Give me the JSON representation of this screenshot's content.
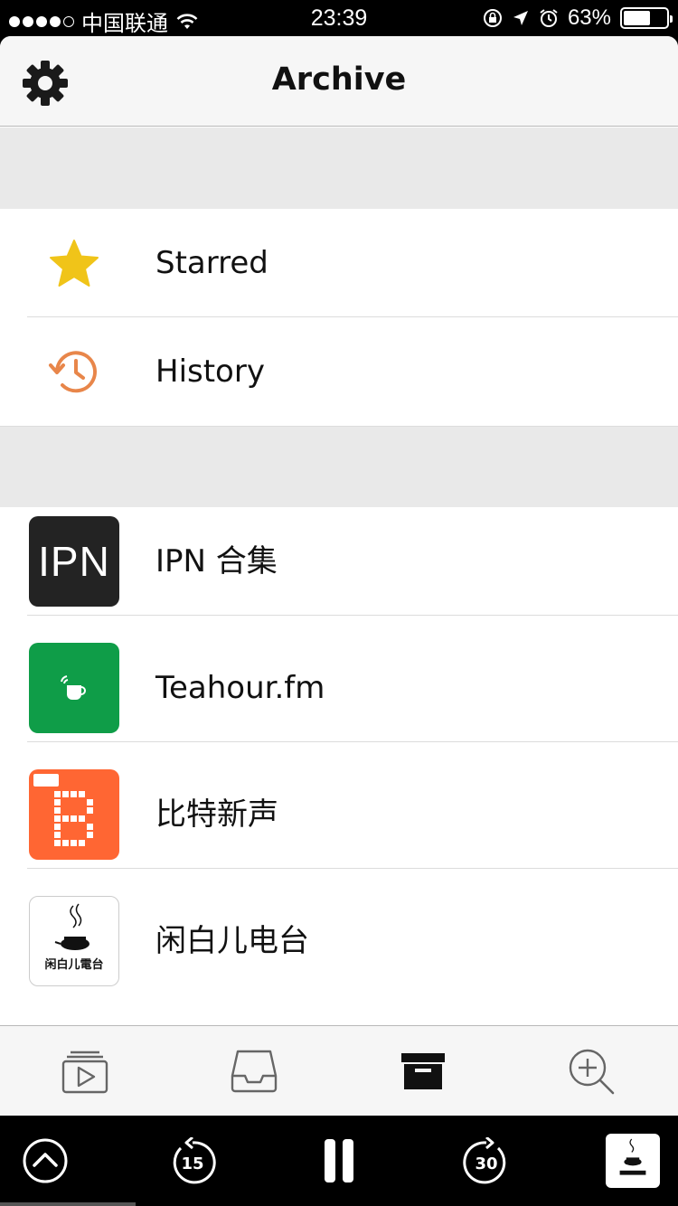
{
  "status_bar": {
    "carrier": "中国联通",
    "time": "23:39",
    "battery_text": "63%",
    "battery_level": 0.63
  },
  "header": {
    "title": "Archive",
    "settings_icon": "gear-icon"
  },
  "archive_items": [
    {
      "label": "Starred",
      "icon": "star-icon",
      "color": "#f0c419"
    },
    {
      "label": "History",
      "icon": "history-icon",
      "color": "#e8864a"
    }
  ],
  "podcasts": [
    {
      "title": "IPN 合集",
      "art_text": "IPN"
    },
    {
      "title": "Teahour.fm"
    },
    {
      "title": "比特新声",
      "art_text": "B"
    },
    {
      "title": "闲白儿电台",
      "art_text": "闲白儿電台"
    }
  ],
  "tabs": [
    {
      "name": "now-playing",
      "icon": "play-queue-icon",
      "active": false
    },
    {
      "name": "inbox",
      "icon": "inbox-icon",
      "active": false
    },
    {
      "name": "archive",
      "icon": "archive-box-icon",
      "active": true
    },
    {
      "name": "search",
      "icon": "search-add-icon",
      "active": false
    }
  ],
  "player": {
    "skip_back_seconds": "15",
    "skip_forward_seconds": "30",
    "state": "playing",
    "progress": 0.2
  },
  "colors": {
    "accent_star": "#f0c419",
    "accent_history": "#e8864a",
    "teahour_green": "#0f9d48",
    "bit_orange": "#ff6633"
  }
}
